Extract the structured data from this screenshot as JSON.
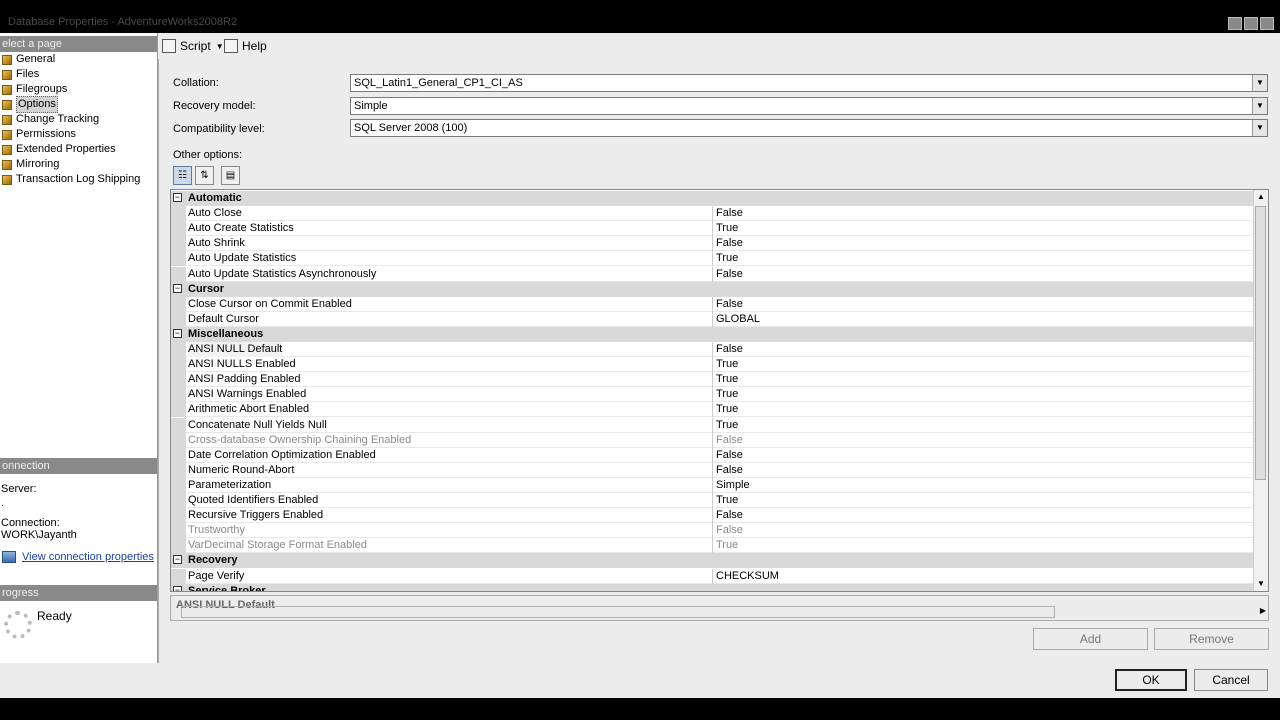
{
  "window": {
    "title": "Database Properties - AdventureWorks2008R2"
  },
  "left_panel": {
    "select_page_header": "elect a page",
    "pages": [
      {
        "label": "General",
        "selected": false
      },
      {
        "label": "Files",
        "selected": false
      },
      {
        "label": "Filegroups",
        "selected": false
      },
      {
        "label": "Options",
        "selected": true
      },
      {
        "label": "Change Tracking",
        "selected": false
      },
      {
        "label": "Permissions",
        "selected": false
      },
      {
        "label": "Extended Properties",
        "selected": false
      },
      {
        "label": "Mirroring",
        "selected": false
      },
      {
        "label": "Transaction Log Shipping",
        "selected": false
      }
    ],
    "connection_header": "onnection",
    "server_label": "Server:",
    "server_value": ".",
    "connection_label": "Connection:",
    "connection_value": "WORK\\Jayanth",
    "view_connection_link": "View connection properties",
    "progress_header": "rogress",
    "progress_status": "Ready"
  },
  "toolbar": {
    "script_label": "Script",
    "help_label": "Help"
  },
  "form": {
    "collation_label": "Collation:",
    "collation_value": "SQL_Latin1_General_CP1_CI_AS",
    "recovery_label": "Recovery model:",
    "recovery_value": "Simple",
    "compat_label": "Compatibility level:",
    "compat_value": "SQL Server 2008 (100)",
    "other_options_label": "Other options:"
  },
  "grid": {
    "rows": [
      {
        "type": "category",
        "name": "Automatic"
      },
      {
        "type": "prop",
        "name": "Auto Close",
        "value": "False"
      },
      {
        "type": "prop",
        "name": "Auto Create Statistics",
        "value": "True"
      },
      {
        "type": "prop",
        "name": "Auto Shrink",
        "value": "False"
      },
      {
        "type": "prop",
        "name": "Auto Update Statistics",
        "value": "True"
      },
      {
        "type": "prop",
        "name": "Auto Update Statistics Asynchronously",
        "value": "False"
      },
      {
        "type": "category",
        "name": "Cursor"
      },
      {
        "type": "prop",
        "name": "Close Cursor on Commit Enabled",
        "value": "False"
      },
      {
        "type": "prop",
        "name": "Default Cursor",
        "value": "GLOBAL"
      },
      {
        "type": "category",
        "name": "Miscellaneous"
      },
      {
        "type": "prop",
        "name": "ANSI NULL Default",
        "value": "False",
        "selected": true
      },
      {
        "type": "prop",
        "name": "ANSI NULLS Enabled",
        "value": "True"
      },
      {
        "type": "prop",
        "name": "ANSI Padding Enabled",
        "value": "True"
      },
      {
        "type": "prop",
        "name": "ANSI Warnings Enabled",
        "value": "True"
      },
      {
        "type": "prop",
        "name": "Arithmetic Abort Enabled",
        "value": "True"
      },
      {
        "type": "prop",
        "name": "Concatenate Null Yields Null",
        "value": "True"
      },
      {
        "type": "prop",
        "name": "Cross-database Ownership Chaining Enabled",
        "value": "False",
        "disabled": true
      },
      {
        "type": "prop",
        "name": "Date Correlation Optimization Enabled",
        "value": "False"
      },
      {
        "type": "prop",
        "name": "Numeric Round-Abort",
        "value": "False"
      },
      {
        "type": "prop",
        "name": "Parameterization",
        "value": "Simple"
      },
      {
        "type": "prop",
        "name": "Quoted Identifiers Enabled",
        "value": "True"
      },
      {
        "type": "prop",
        "name": "Recursive Triggers Enabled",
        "value": "False"
      },
      {
        "type": "prop",
        "name": "Trustworthy",
        "value": "False",
        "disabled": true
      },
      {
        "type": "prop",
        "name": "VarDecimal Storage Format Enabled",
        "value": "True",
        "disabled": true
      },
      {
        "type": "category",
        "name": "Recovery"
      },
      {
        "type": "prop",
        "name": "Page Verify",
        "value": "CHECKSUM"
      },
      {
        "type": "category",
        "name": "Service Broker"
      }
    ]
  },
  "description": {
    "title": "ANSI NULL Default"
  },
  "buttons": {
    "add": "Add",
    "remove": "Remove",
    "ok": "OK",
    "cancel": "Cancel"
  }
}
